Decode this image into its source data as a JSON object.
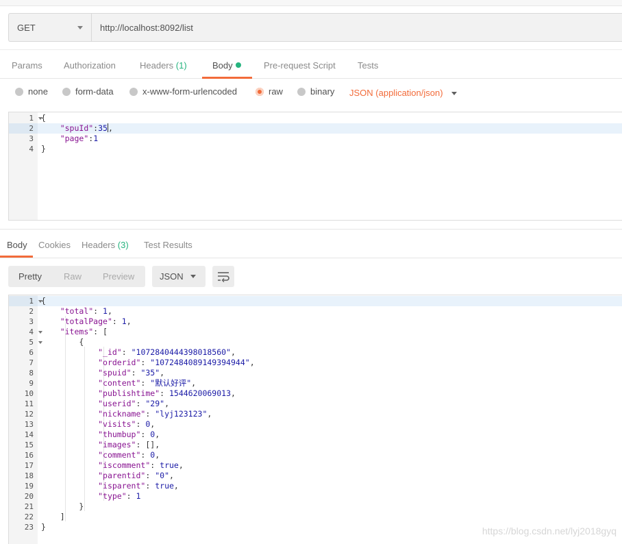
{
  "request": {
    "method": "GET",
    "url": "http://localhost:8092/list",
    "tabs": [
      {
        "label": "Params"
      },
      {
        "label": "Authorization"
      },
      {
        "label": "Headers",
        "count": "(1)"
      },
      {
        "label": "Body"
      },
      {
        "label": "Pre-request Script"
      },
      {
        "label": "Tests"
      }
    ],
    "active_tab": "Body",
    "body_modes": [
      "none",
      "form-data",
      "x-www-form-urlencoded",
      "raw",
      "binary"
    ],
    "selected_mode": "raw",
    "body_type": "JSON (application/json)",
    "editor_lines": [
      {
        "n": "1",
        "text": "{"
      },
      {
        "n": "2",
        "text": "    \"spuId\":35,"
      },
      {
        "n": "3",
        "text": "    \"page\":1"
      },
      {
        "n": "4",
        "text": "}"
      }
    ]
  },
  "response": {
    "tabs": [
      {
        "label": "Body"
      },
      {
        "label": "Cookies"
      },
      {
        "label": "Headers",
        "count": "(3)"
      },
      {
        "label": "Test Results"
      }
    ],
    "active_tab": "Body",
    "view_modes": [
      "Pretty",
      "Raw",
      "Preview"
    ],
    "active_view": "Pretty",
    "format": "JSON",
    "lines": [
      {
        "n": "1",
        "text": "{"
      },
      {
        "n": "2",
        "text": "    \"total\": 1,"
      },
      {
        "n": "3",
        "text": "    \"totalPage\": 1,"
      },
      {
        "n": "4",
        "text": "    \"items\": ["
      },
      {
        "n": "5",
        "text": "        {"
      },
      {
        "n": "6",
        "text": "            \"_id\": \"1072840444398018560\","
      },
      {
        "n": "7",
        "text": "            \"orderid\": \"1072484089149394944\","
      },
      {
        "n": "8",
        "text": "            \"spuid\": \"35\","
      },
      {
        "n": "9",
        "text": "            \"content\": \"默认好评\","
      },
      {
        "n": "10",
        "text": "            \"publishtime\": 1544620069013,"
      },
      {
        "n": "11",
        "text": "            \"userid\": \"29\","
      },
      {
        "n": "12",
        "text": "            \"nickname\": \"lyj123123\","
      },
      {
        "n": "13",
        "text": "            \"visits\": 0,"
      },
      {
        "n": "14",
        "text": "            \"thumbup\": 0,"
      },
      {
        "n": "15",
        "text": "            \"images\": [],"
      },
      {
        "n": "16",
        "text": "            \"comment\": 0,"
      },
      {
        "n": "17",
        "text": "            \"iscomment\": true,"
      },
      {
        "n": "18",
        "text": "            \"parentid\": \"0\","
      },
      {
        "n": "19",
        "text": "            \"isparent\": true,"
      },
      {
        "n": "20",
        "text": "            \"type\": 1"
      },
      {
        "n": "21",
        "text": "        }"
      },
      {
        "n": "22",
        "text": "    ]"
      },
      {
        "n": "23",
        "text": "}"
      }
    ]
  },
  "watermark": "https://blog.csdn.net/lyj2018gyq",
  "colors": {
    "accent": "#f26b3a",
    "count_green": "#26b47f",
    "json_key": "#881391",
    "json_value": "#1a1aa6"
  }
}
